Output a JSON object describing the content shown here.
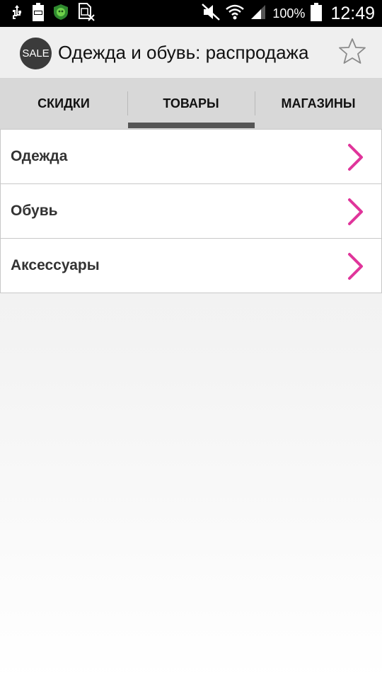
{
  "status_bar": {
    "battery_percent": "100%",
    "time": "12:49",
    "icons": [
      "usb-icon",
      "battery-saver-icon",
      "shield-app-icon",
      "sim-off-icon",
      "mute-icon",
      "wifi-icon",
      "signal-icon",
      "battery-icon"
    ]
  },
  "app_bar": {
    "logo_text": "SALE",
    "title": "Одежда и обувь: распродажа"
  },
  "tabs": [
    {
      "label": "СКИДКИ"
    },
    {
      "label": "ТОВАРЫ",
      "selected": true
    },
    {
      "label": "МАГАЗИНЫ"
    }
  ],
  "categories": [
    {
      "label": "Одежда"
    },
    {
      "label": "Обувь"
    },
    {
      "label": "Аксессуары"
    }
  ],
  "colors": {
    "accent": "#e0359b",
    "tab_indicator": "#555555",
    "tab_background": "#d8d8d8",
    "app_bar_background": "#efefef"
  }
}
